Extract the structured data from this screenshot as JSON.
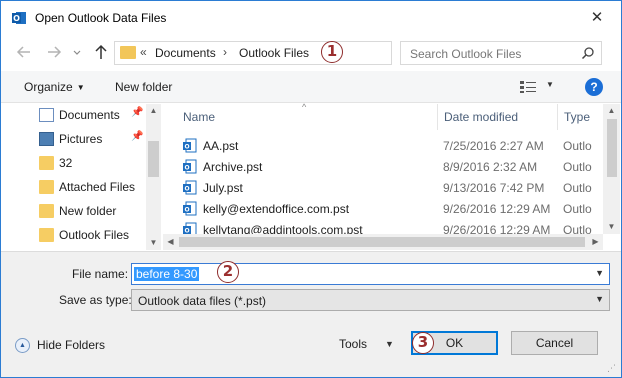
{
  "window": {
    "title": "Open Outlook Data Files",
    "close_label": "✕"
  },
  "nav": {
    "back_icon": "arrow-left-icon",
    "forward_icon": "arrow-right-icon",
    "recent_icon": "chevron-down-icon",
    "up_icon": "arrow-up-icon"
  },
  "address": {
    "overflow": "«",
    "crumbs": [
      "Documents",
      "Outlook Files"
    ],
    "separator": "›"
  },
  "search": {
    "placeholder": "Search Outlook Files"
  },
  "toolbar": {
    "organize_label": "Organize",
    "new_folder_label": "New folder",
    "help_label": "?"
  },
  "sidebar": {
    "items": [
      {
        "label": "Documents",
        "icon": "documents-icon",
        "pinned": true
      },
      {
        "label": "Pictures",
        "icon": "pictures-icon",
        "pinned": true
      },
      {
        "label": "32",
        "icon": "folder-icon",
        "pinned": false
      },
      {
        "label": "Attached Files",
        "icon": "folder-icon",
        "pinned": false
      },
      {
        "label": "New folder",
        "icon": "folder-icon",
        "pinned": false
      },
      {
        "label": "Outlook Files",
        "icon": "folder-icon",
        "pinned": false
      }
    ]
  },
  "filelist": {
    "columns": [
      "Name",
      "Date modified",
      "Type"
    ],
    "rows": [
      {
        "name": "AA.pst",
        "date": "7/25/2016 2:27 AM",
        "type": "Outlo"
      },
      {
        "name": "Archive.pst",
        "date": "8/9/2016 2:32 AM",
        "type": "Outlo"
      },
      {
        "name": "July.pst",
        "date": "9/13/2016 7:42 PM",
        "type": "Outlo"
      },
      {
        "name": "kelly@extendoffice.com.pst",
        "date": "9/26/2016 12:29 AM",
        "type": "Outlo"
      },
      {
        "name": "kellytanq@addintools.com.pst",
        "date": "9/26/2016 12:29 AM",
        "type": "Outlo"
      }
    ]
  },
  "form": {
    "file_name_label": "File name:",
    "file_name_value": "before 8-30",
    "save_type_label": "Save as type:",
    "save_type_value": "Outlook data files (*.pst)"
  },
  "footer": {
    "hide_folders_label": "Hide Folders",
    "tools_label": "Tools",
    "ok_label": "OK",
    "cancel_label": "Cancel"
  },
  "callouts": [
    "1",
    "2",
    "3"
  ],
  "colors": {
    "accent": "#0078d7",
    "selection": "#3399ff",
    "callout": "#9b2f2f",
    "folder": "#f6cd63"
  }
}
